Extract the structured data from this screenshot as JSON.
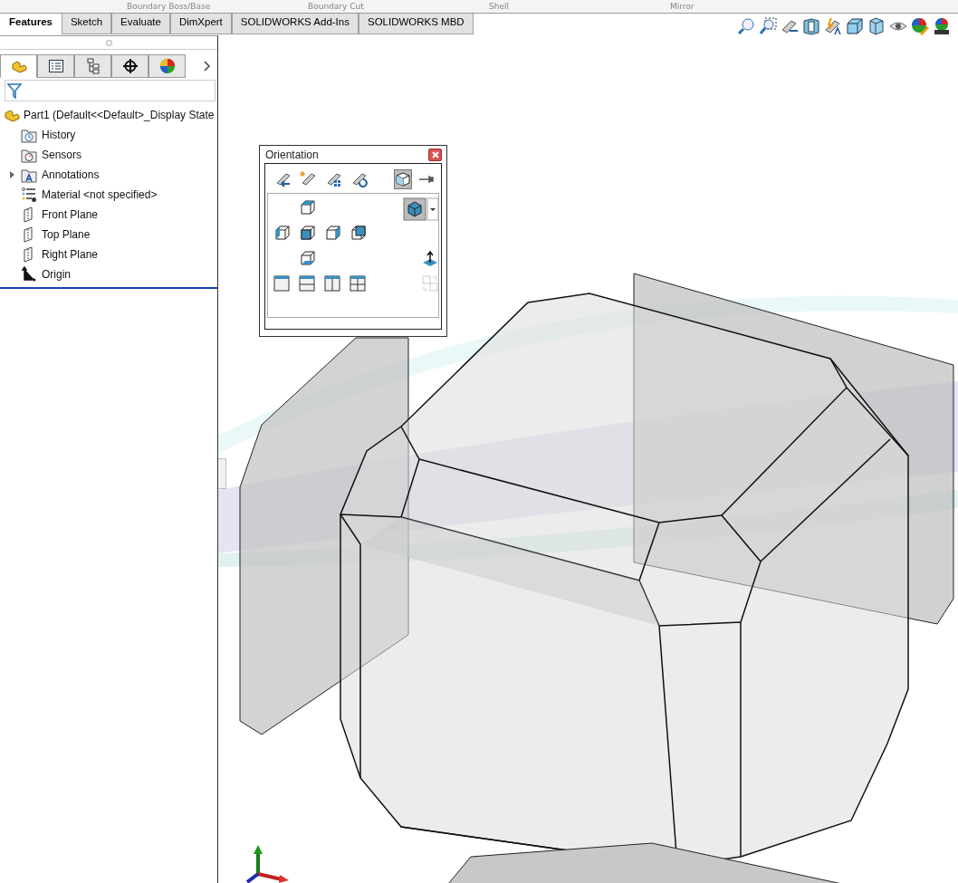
{
  "command_strip": [
    {
      "label": "Boundary Boss/Base",
      "disabled": true
    },
    {
      "label": "Boundary Cut",
      "disabled": true
    },
    {
      "label": "Shell",
      "disabled": true
    },
    {
      "label": "Mirror",
      "disabled": true
    }
  ],
  "tabs": [
    {
      "label": "Features",
      "selected": true
    },
    {
      "label": "Sketch",
      "selected": false
    },
    {
      "label": "Evaluate",
      "selected": false
    },
    {
      "label": "DimXpert",
      "selected": false
    },
    {
      "label": "SOLIDWORKS Add-Ins",
      "selected": false
    },
    {
      "label": "SOLIDWORKS MBD",
      "selected": false
    }
  ],
  "panel_tabs": [
    {
      "kind": "features",
      "selected": true
    },
    {
      "kind": "properties",
      "selected": false
    },
    {
      "kind": "configurations",
      "selected": false
    },
    {
      "kind": "dimxpert",
      "selected": false
    },
    {
      "kind": "display",
      "selected": false
    }
  ],
  "tree": {
    "label": "Part1  (Default<<Default>_Display State",
    "children": [
      {
        "label": "History",
        "kind": "history"
      },
      {
        "label": "Sensors",
        "kind": "sensors"
      },
      {
        "label": "Annotations",
        "kind": "annotations",
        "expanded": false
      },
      {
        "label": "Material <not specified>",
        "kind": "material"
      },
      {
        "label": "Front Plane",
        "kind": "plane"
      },
      {
        "label": "Top Plane",
        "kind": "plane"
      },
      {
        "label": "Right Plane",
        "kind": "plane"
      },
      {
        "label": "Origin",
        "kind": "origin"
      }
    ]
  },
  "orientation": {
    "title": "Orientation",
    "tools": [
      {
        "kind": "new-view",
        "selected": false
      },
      {
        "kind": "new-view-star",
        "selected": false
      },
      {
        "kind": "update-view",
        "selected": false
      },
      {
        "kind": "reset-view",
        "selected": false
      },
      {
        "kind": "view-cube",
        "selected": true
      },
      {
        "kind": "pin",
        "selected": false
      }
    ]
  }
}
